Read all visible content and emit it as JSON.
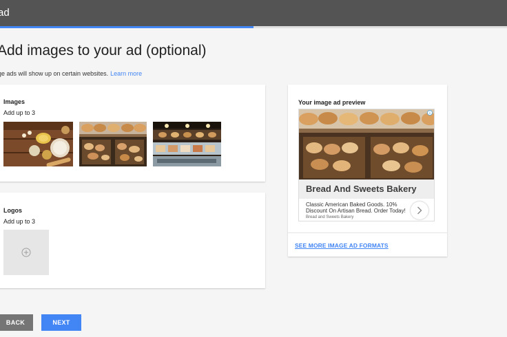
{
  "header": {
    "title": "ad",
    "progress_percent": 50
  },
  "page": {
    "title": "Add images to your ad (optional)",
    "subtitle": "ge ads will show up on certain websites.",
    "learn_more": "Learn more"
  },
  "images_section": {
    "title": "Images",
    "subtitle": "Add up to 3",
    "thumbnails": [
      "baking-ingredients-image",
      "bakery-display-image",
      "bakery-counter-image"
    ]
  },
  "logos_section": {
    "title": "Logos",
    "subtitle": "Add up to 3",
    "add_icon": "plus-circle-icon"
  },
  "preview": {
    "title": "Your image ad preview",
    "headline": "Bread And Sweets Bakery",
    "description": "Classic American Baked Goods. 10% Discount On Artisan Bread. Order Today!",
    "display_url": "Bread and Sweets Bakery",
    "see_more": "SEE MORE IMAGE AD FORMATS",
    "info_icon": "info-icon",
    "arrow_icon": "chevron-right-icon"
  },
  "footer": {
    "back_label": "BACK",
    "next_label": "NEXT"
  },
  "colors": {
    "accent": "#4285f4",
    "topbar": "#545454",
    "back_button": "#757575"
  }
}
